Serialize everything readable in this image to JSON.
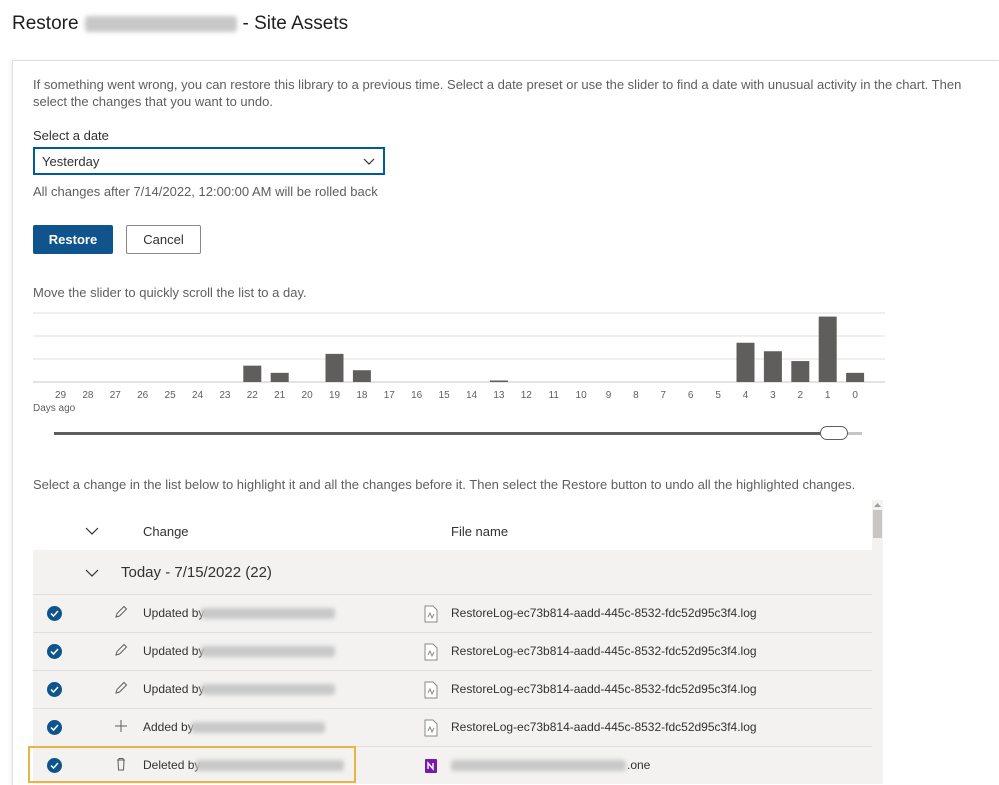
{
  "header": {
    "title_prefix": "Restore",
    "title_suffix": "- Site Assets"
  },
  "intro": "If something went wrong, you can restore this library to a previous time. Select a date preset or use the slider to find a date with unusual activity in the chart. Then select the changes that you want to undo.",
  "date_select": {
    "label": "Select a date",
    "value": "Yesterday",
    "icon": "chevron-down-icon"
  },
  "rollback_text": "All changes after 7/14/2022, 12:00:00 AM will be rolled back",
  "buttons": {
    "restore": "Restore",
    "cancel": "Cancel"
  },
  "slider_hint": "Move the slider to quickly scroll the list to a day.",
  "chart_data": {
    "type": "bar",
    "categories": [
      "29",
      "28",
      "27",
      "26",
      "25",
      "24",
      "23",
      "22",
      "21",
      "20",
      "19",
      "18",
      "17",
      "16",
      "15",
      "14",
      "13",
      "12",
      "11",
      "10",
      "9",
      "8",
      "7",
      "6",
      "5",
      "4",
      "3",
      "2",
      "1",
      "0"
    ],
    "values": [
      0,
      0,
      0,
      0,
      0,
      0,
      0,
      0.25,
      0.14,
      0,
      0.43,
      0.18,
      0,
      0,
      0,
      0,
      0.02,
      0,
      0,
      0,
      0,
      0,
      0,
      0,
      0,
      0.6,
      0.47,
      0.32,
      1.0,
      0.14
    ],
    "xlabel": "Days ago",
    "grid": true,
    "ylim": [
      0,
      1.07
    ]
  },
  "slider": {
    "value_days_ago": 1,
    "range_days_ago": [
      29,
      0
    ]
  },
  "select_hint": "Select a change in the list below to highlight it and all the changes before it. Then select the Restore button to undo all the highlighted changes.",
  "list": {
    "columns": {
      "change": "Change",
      "file": "File name"
    },
    "group": {
      "title": "Today - 7/15/2022 (22)"
    },
    "rows": [
      {
        "action": "Updated by",
        "file": "RestoreLog-ec73b814-aadd-445c-8532-fdc52d95c3f4.log",
        "icon": "pencil-icon",
        "file_icon": "log-file-icon"
      },
      {
        "action": "Updated by",
        "file": "RestoreLog-ec73b814-aadd-445c-8532-fdc52d95c3f4.log",
        "icon": "pencil-icon",
        "file_icon": "log-file-icon"
      },
      {
        "action": "Updated by",
        "file": "RestoreLog-ec73b814-aadd-445c-8532-fdc52d95c3f4.log",
        "icon": "pencil-icon",
        "file_icon": "log-file-icon"
      },
      {
        "action": "Added by",
        "file": "RestoreLog-ec73b814-aadd-445c-8532-fdc52d95c3f4.log",
        "icon": "plus-icon",
        "file_icon": "log-file-icon"
      },
      {
        "action": "Deleted by",
        "file": ".one",
        "icon": "trash-icon",
        "file_icon": "onenote-file-icon"
      }
    ]
  },
  "colors": {
    "accent": "#0f548c",
    "highlight": "#e8b545",
    "bar": "#605e5c"
  }
}
